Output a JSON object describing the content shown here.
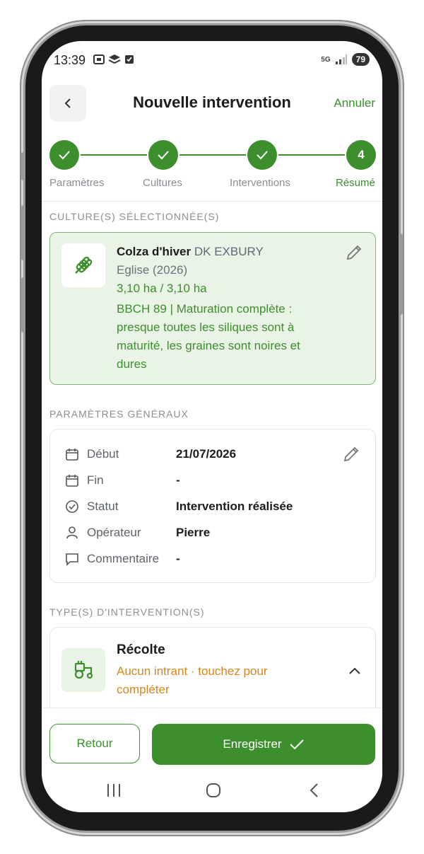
{
  "status_bar": {
    "time": "13:39",
    "battery": "79",
    "network": "5G"
  },
  "header": {
    "title": "Nouvelle intervention",
    "cancel_label": "Annuler"
  },
  "stepper": {
    "steps": [
      {
        "label": "Paramètres",
        "state": "done"
      },
      {
        "label": "Cultures",
        "state": "done"
      },
      {
        "label": "Interventions",
        "state": "done"
      },
      {
        "label": "Résumé",
        "state": "active",
        "number": "4"
      }
    ]
  },
  "cultures": {
    "section_title": "CULTURE(S) SÉLECTIONNÉE(S)",
    "item": {
      "crop": "Colza d'hiver",
      "variety": "DK EXBURY",
      "plot": "Eglise (2026)",
      "area": "3,10 ha / 3,10 ha",
      "bbch": "BBCH 89 | Maturation complète : presque toutes les siliques sont à maturité, les graines sont noires et dures"
    }
  },
  "general_params": {
    "section_title": "PARAMÈTRES GÉNÉRAUX",
    "rows": [
      {
        "icon": "calendar-icon",
        "label": "Début",
        "value": "21/07/2026"
      },
      {
        "icon": "calendar-icon",
        "label": "Fin",
        "value": "-"
      },
      {
        "icon": "check-circle-icon",
        "label": "Statut",
        "value": "Intervention réalisée"
      },
      {
        "icon": "user-icon",
        "label": "Opérateur",
        "value": "Pierre"
      },
      {
        "icon": "comment-icon",
        "label": "Commentaire",
        "value": "-"
      }
    ]
  },
  "intervention_types": {
    "section_title": "TYPE(S) D'INTERVENTION(S)",
    "item": {
      "name": "Récolte",
      "status": "Aucun intrant · touchez pour compléter"
    }
  },
  "actions": {
    "back_label": "Retour",
    "save_label": "Enregistrer"
  },
  "colors": {
    "primary": "#3d8f2e",
    "warning": "#d9851a",
    "card_bg": "#e9f4e6"
  }
}
